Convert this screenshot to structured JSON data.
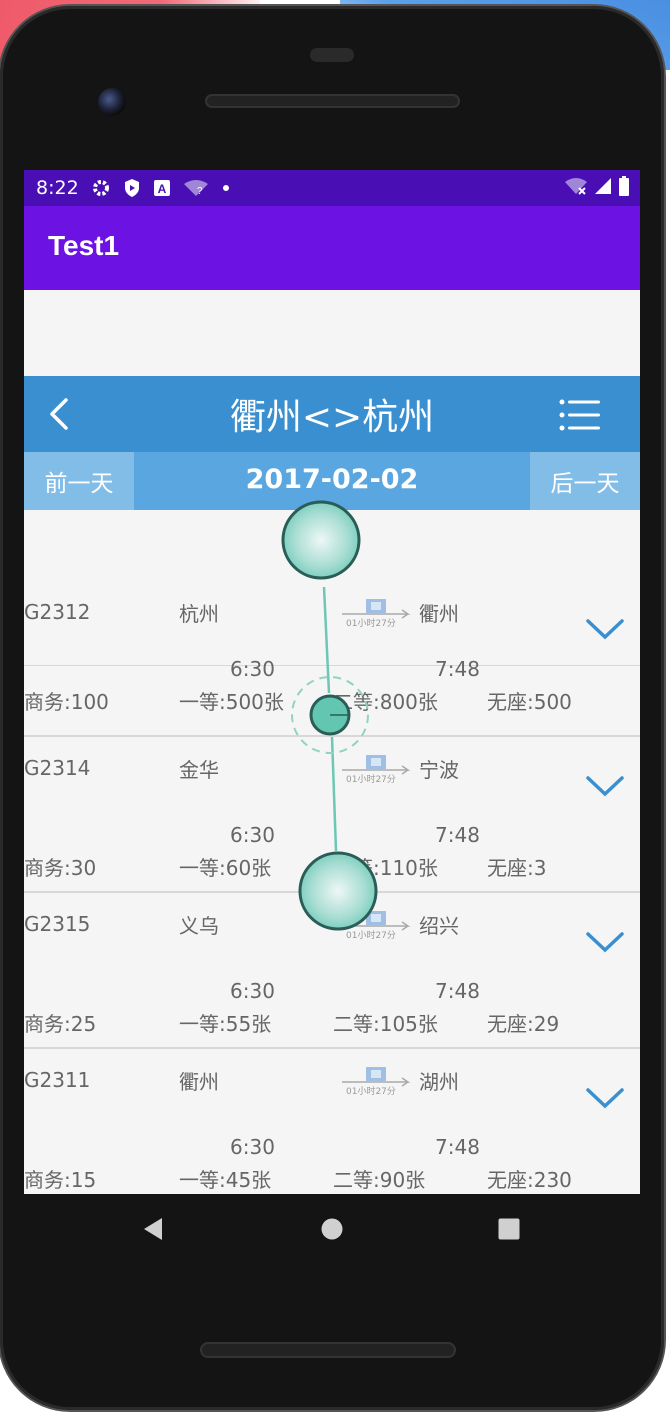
{
  "status_bar": {
    "time": "8:22"
  },
  "app_bar": {
    "title": "Test1"
  },
  "route_header": {
    "title": "衢州<>杭州"
  },
  "date_bar": {
    "prev_label": "前一天",
    "date": "2017-02-02",
    "next_label": "后一天"
  },
  "duration_label": "01小时27分",
  "trains": [
    {
      "number": "G2312",
      "from": "杭州",
      "to": "衢州",
      "depart": "6:30",
      "arrive": "7:48",
      "business": "商务:100",
      "first": "一等:500张",
      "second": "二等:800张",
      "no_seat": "无座:500"
    },
    {
      "number": "G2314",
      "from": "金华",
      "to": "宁波",
      "depart": "6:30",
      "arrive": "7:48",
      "business": "商务:30",
      "first": "一等:60张",
      "second": "二等:110张",
      "no_seat": "无座:3"
    },
    {
      "number": "G2315",
      "from": "义乌",
      "to": "绍兴",
      "depart": "6:30",
      "arrive": "7:48",
      "business": "商务:25",
      "first": "一等:55张",
      "second": "二等:105张",
      "no_seat": "无座:29"
    },
    {
      "number": "G2311",
      "from": "衢州",
      "to": "湖州",
      "depart": "6:30",
      "arrive": "7:48",
      "business": "商务:15",
      "first": "一等:45张",
      "second": "二等:90张",
      "no_seat": "无座:230"
    }
  ],
  "colors": {
    "status_bar": "#4a0fb4",
    "app_bar": "#6c13e4",
    "route_header": "#3a8fd0",
    "date_bar": "#5aa6e0",
    "chevron": "#3a8fd0",
    "touch_indicator": "#7fd0c0"
  },
  "icons": [
    "settings-icon",
    "shield-icon",
    "font-icon",
    "wifi-question-icon",
    "wifi-off-icon",
    "signal-icon",
    "battery-icon",
    "back-icon",
    "menu-icon",
    "chevron-down-icon",
    "nav-back-icon",
    "nav-home-icon",
    "nav-recents-icon"
  ]
}
